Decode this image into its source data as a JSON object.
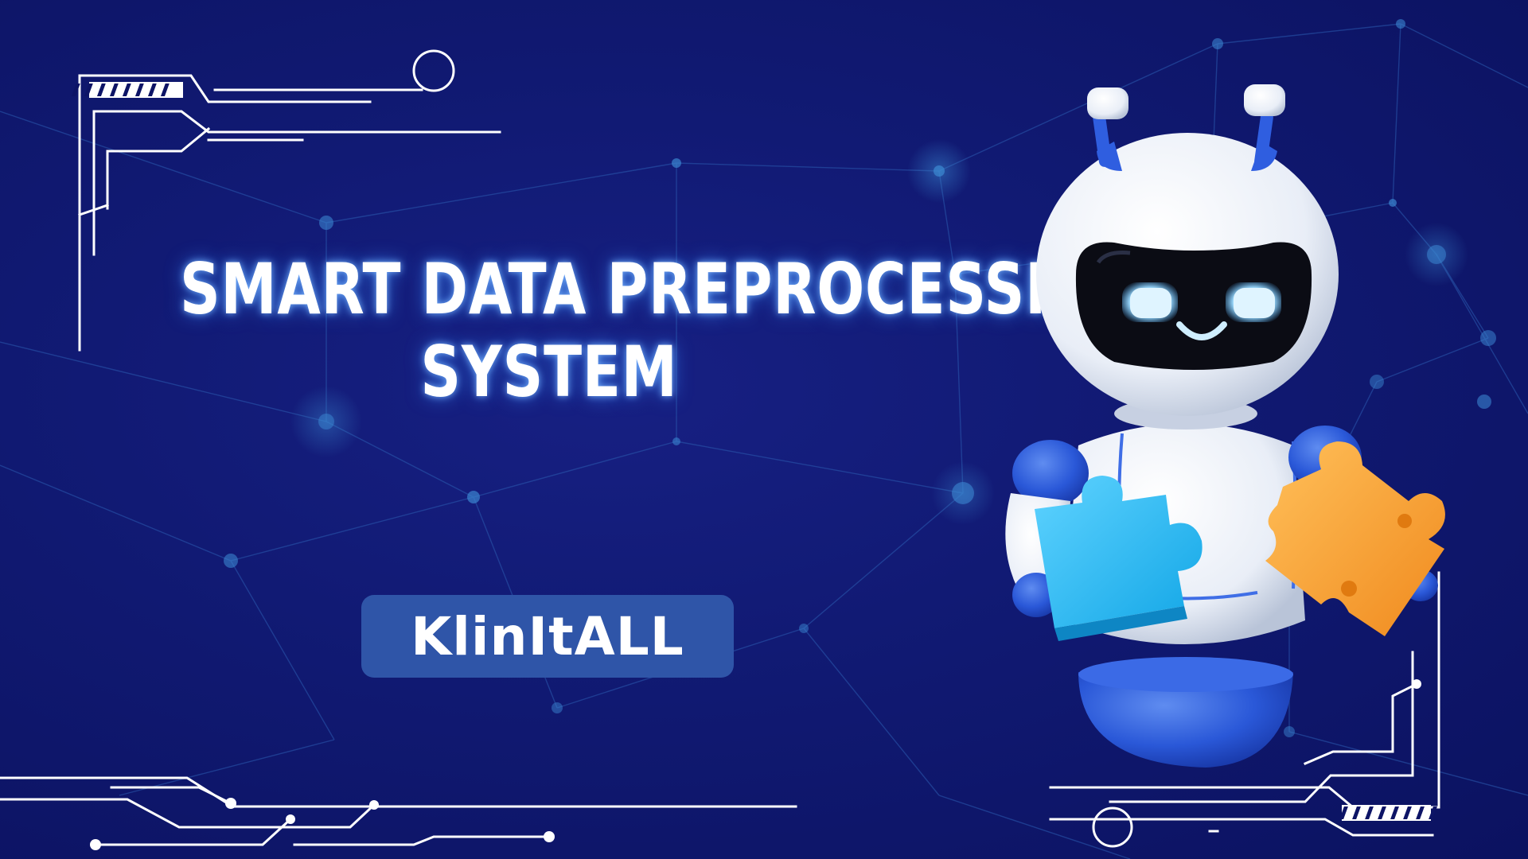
{
  "headline": {
    "line1": "SMART DATA PREPROCESSING",
    "line2": "SYSTEM"
  },
  "brand": {
    "name": "KlinItALL"
  },
  "illustration": {
    "robot": "robot-mascot-icon",
    "left_piece": "blue-puzzle-piece-icon",
    "right_piece": "orange-puzzle-piece-icon"
  },
  "colors": {
    "background": "#111a74",
    "badge": "#2f55a8",
    "circuit": "#ffffff",
    "network": "#2a62b8"
  }
}
